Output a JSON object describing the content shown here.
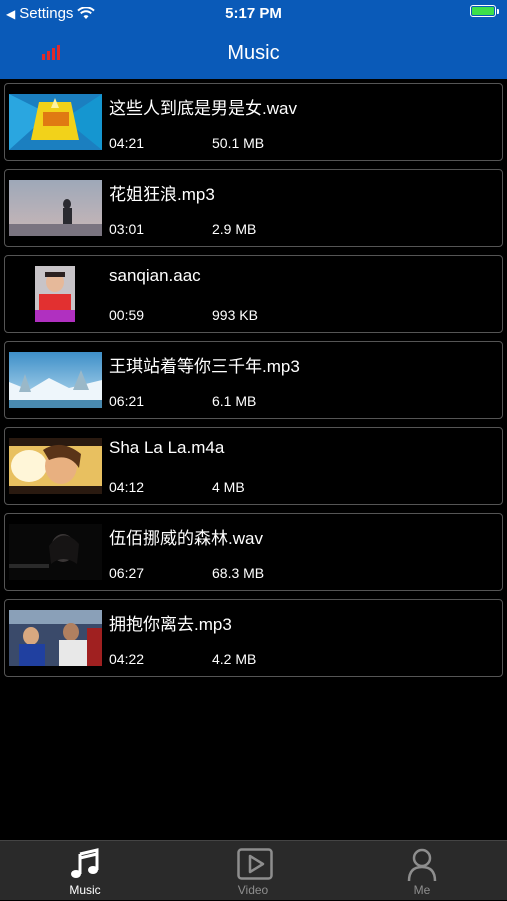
{
  "status": {
    "carrier": "Settings",
    "time": "5:17 PM"
  },
  "header": {
    "title": "Music"
  },
  "items": [
    {
      "title": "这些人到底是男是女.wav",
      "duration": "04:21",
      "size": "50.1 MB"
    },
    {
      "title": "花姐狂浪.mp3",
      "duration": "03:01",
      "size": "2.9 MB"
    },
    {
      "title": "sanqian.aac",
      "duration": "00:59",
      "size": "993 KB"
    },
    {
      "title": "王琪站着等你三千年.mp3",
      "duration": "06:21",
      "size": "6.1 MB"
    },
    {
      "title": "Sha La La.m4a",
      "duration": "04:12",
      "size": "4 MB"
    },
    {
      "title": "伍佰挪威的森林.wav",
      "duration": "06:27",
      "size": "68.3 MB"
    },
    {
      "title": "拥抱你离去.mp3",
      "duration": "04:22",
      "size": "4.2 MB"
    }
  ],
  "tabs": [
    {
      "label": "Music",
      "icon": "music-note-icon"
    },
    {
      "label": "Video",
      "icon": "video-play-icon"
    },
    {
      "label": "Me",
      "icon": "person-icon"
    }
  ],
  "colors": {
    "header": "#0a5ab8",
    "tab_active": "#ffffff",
    "tab_inactive": "#8e8e8e",
    "battery": "#3de04a",
    "signal_icon": "#e02a2a"
  }
}
